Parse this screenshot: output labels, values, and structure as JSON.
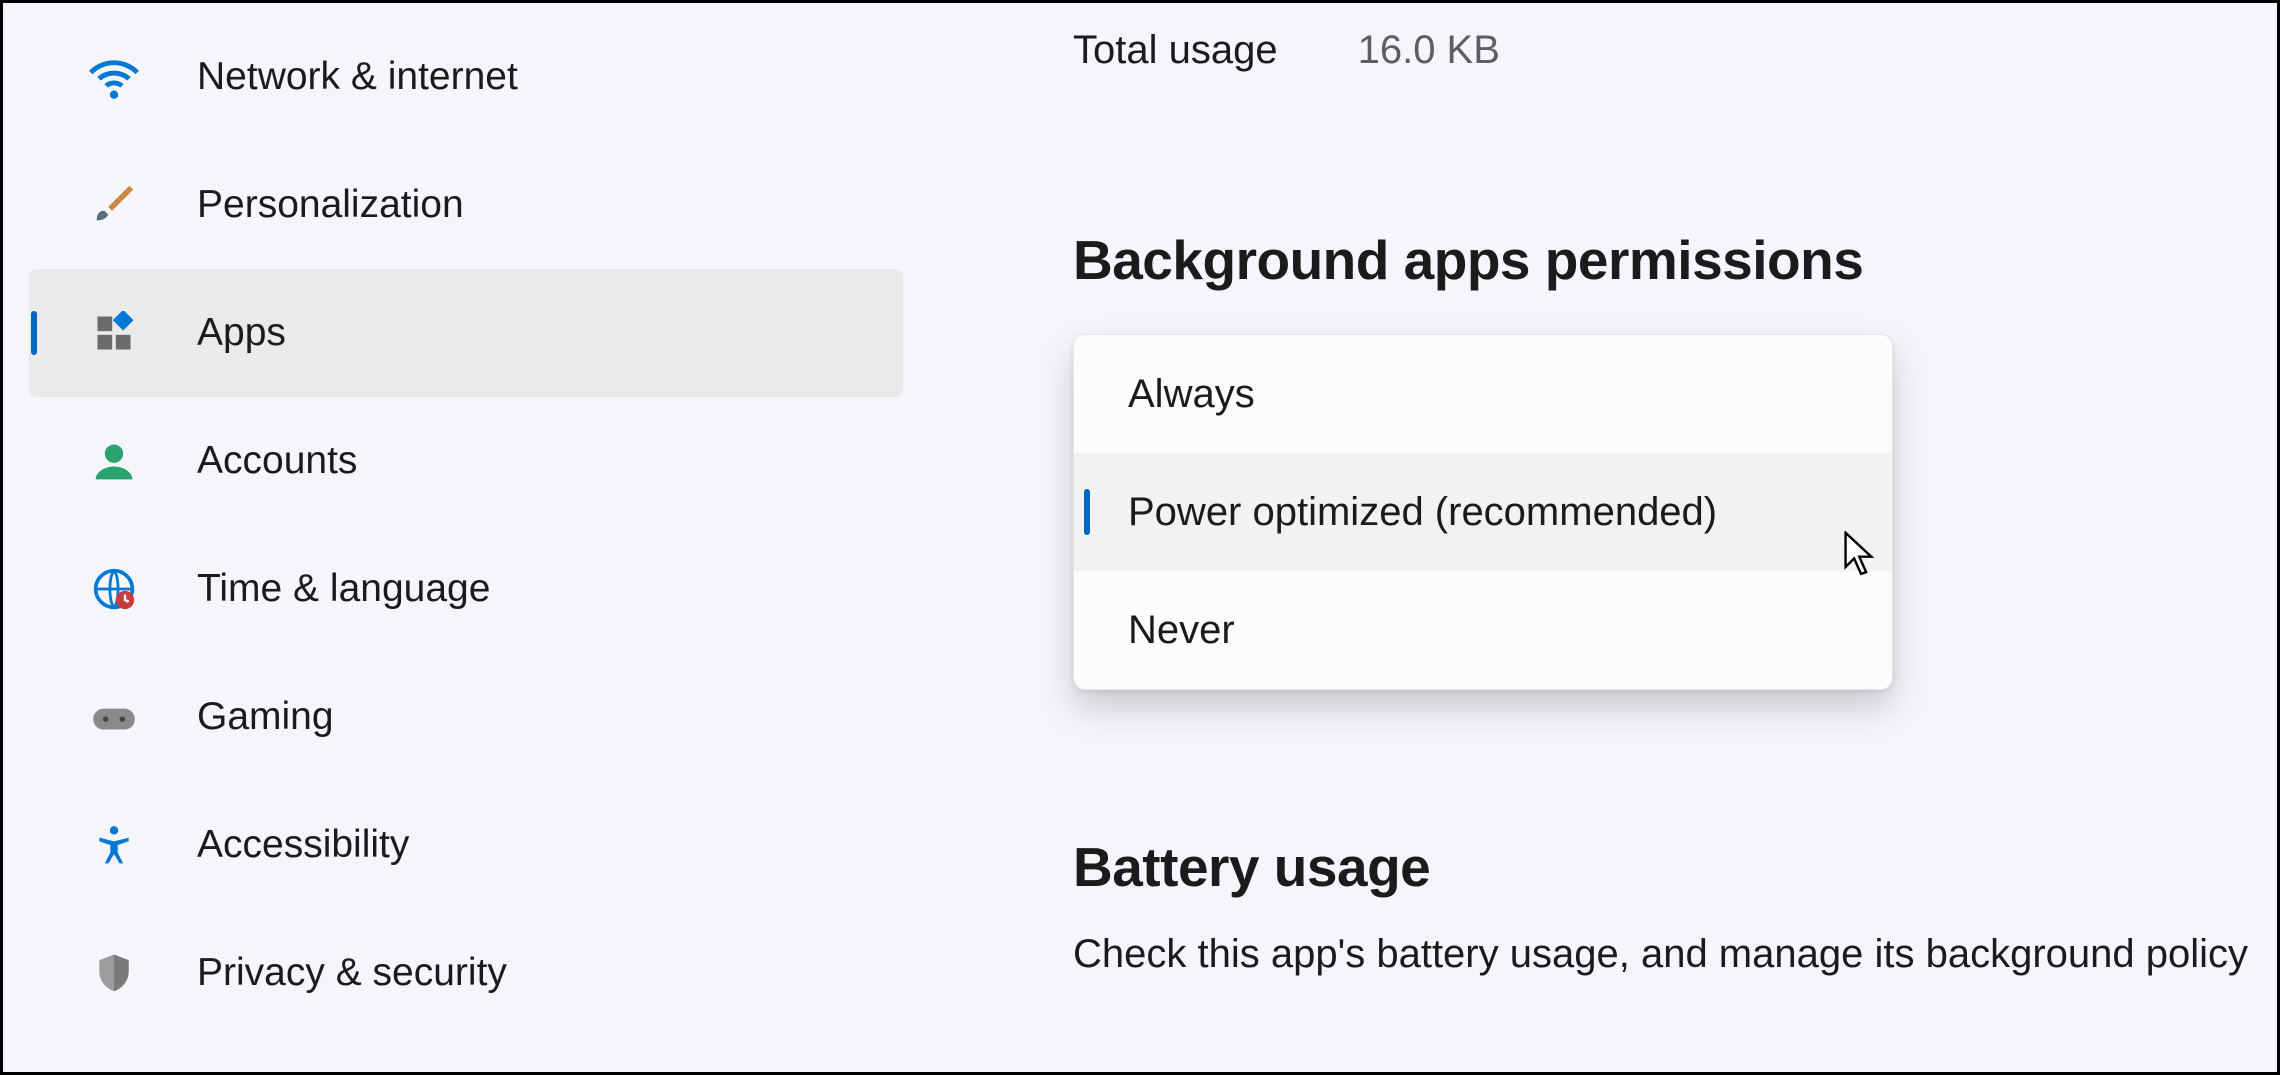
{
  "sidebar": {
    "items": [
      {
        "label": "Network & internet",
        "icon": "wifi-icon"
      },
      {
        "label": "Personalization",
        "icon": "brush-icon"
      },
      {
        "label": "Apps",
        "icon": "apps-icon"
      },
      {
        "label": "Accounts",
        "icon": "person-icon"
      },
      {
        "label": "Time & language",
        "icon": "globe-clock-icon"
      },
      {
        "label": "Gaming",
        "icon": "gamepad-icon"
      },
      {
        "label": "Accessibility",
        "icon": "accessibility-icon"
      },
      {
        "label": "Privacy & security",
        "icon": "shield-icon"
      }
    ],
    "selected_index": 2
  },
  "main": {
    "total_usage_label": "Total usage",
    "total_usage_value": "16.0 KB",
    "bg_permissions_heading": "Background apps permissions",
    "bg_permissions_options": [
      "Always",
      "Power optimized (recommended)",
      "Never"
    ],
    "bg_permissions_selected_index": 1,
    "battery_heading": "Battery usage",
    "battery_desc": "Check this app's battery usage, and manage its background policy"
  }
}
